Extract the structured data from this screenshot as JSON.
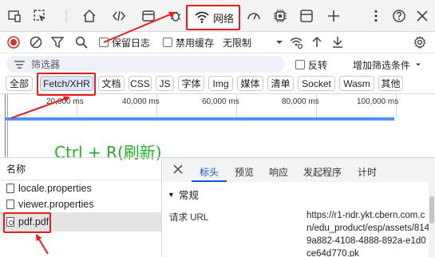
{
  "tabs": {
    "network_label": "网络",
    "icons": [
      "device-toggle-icon",
      "inspect-icon",
      "home-icon",
      "sources-code-icon",
      "application-icon",
      "debug-bug-icon",
      "wifi-icon",
      "performance-gauge-icon",
      "memory-chip-icon",
      "layers-window-icon",
      "add-icon",
      "more-icon",
      "help-icon",
      "close-icon"
    ]
  },
  "toolbar": {
    "preserve_log": "保留日志",
    "disable_cache": "禁用缓存",
    "throttling": "无限制"
  },
  "filter": {
    "placeholder": "筛选器",
    "invert": "反转",
    "more_filters": "增加筛选条件"
  },
  "type_filters": [
    "全部",
    "Fetch/XHR",
    "文档",
    "CSS",
    "JS",
    "字体",
    "Img",
    "媒体",
    "清单",
    "Socket",
    "Wasm",
    "其他"
  ],
  "timeline": {
    "ticks": [
      "20,000 ms",
      "40,000 ms",
      "60,000 ms",
      "80,000 ms",
      "100,000 ms"
    ]
  },
  "annotation": {
    "text": "Ctrl + R(刷新)",
    "color": "#22b022",
    "highlight_color": "#e81b1b"
  },
  "requests": {
    "header": "名称",
    "files": [
      "locale.properties",
      "viewer.properties",
      "pdf.pdf"
    ],
    "selected": "pdf.pdf"
  },
  "detail": {
    "tabs": [
      "标头",
      "预览",
      "响应",
      "发起程序",
      "计时"
    ],
    "active_tab": "标头",
    "section": "常规",
    "request_url_label": "请求 URL",
    "request_url_value": "https://r1-ndr.ykt.cbern.com.cn/edu_product/esp/assets/8149a882-4108-4888-892a-e1d0ce64d770.pk"
  },
  "colors": {
    "accent": "#0b57d0",
    "record": "#d93025",
    "waterfall": "#4f8ff7"
  }
}
